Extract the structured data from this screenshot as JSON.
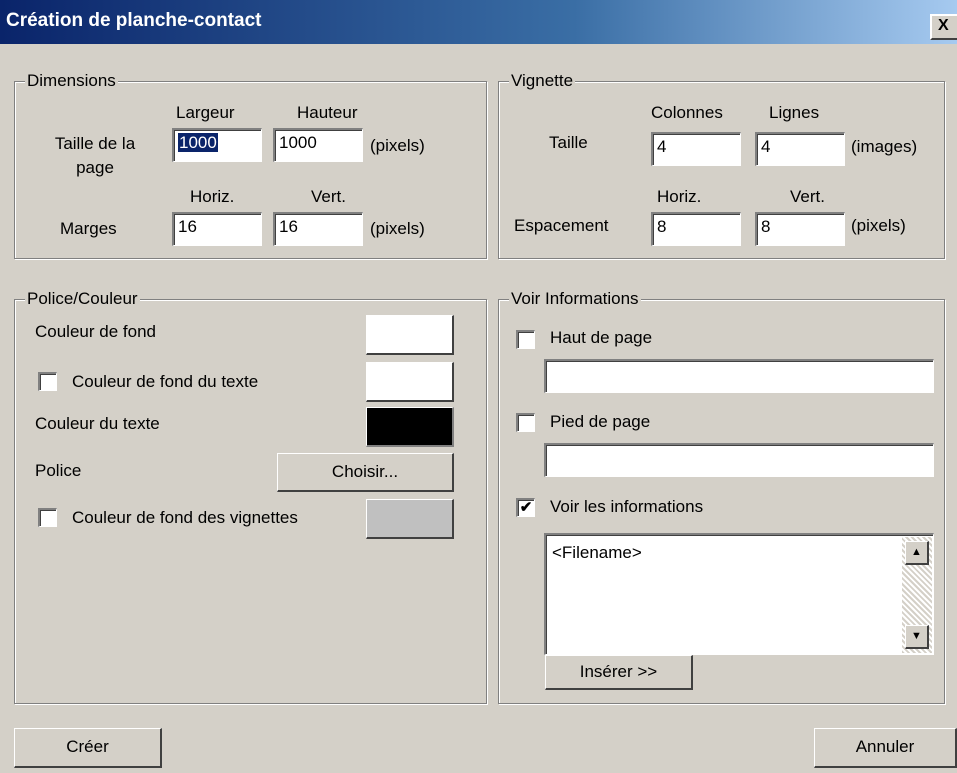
{
  "window": {
    "title": "Création de planche-contact",
    "close_label": "X"
  },
  "dimensions": {
    "legend": "Dimensions",
    "col_width": "Largeur",
    "col_height": "Hauteur",
    "page_size_label": "Taille de la page",
    "page_width": "1000",
    "page_height": "1000",
    "unit1": "(pixels)",
    "col_horiz": "Horiz.",
    "col_vert": "Vert.",
    "margins_label": "Marges",
    "margin_h": "16",
    "margin_v": "16",
    "unit2": "(pixels)"
  },
  "thumbnail": {
    "legend": "Vignette",
    "col_columns": "Colonnes",
    "col_rows": "Lignes",
    "size_label": "Taille",
    "columns": "4",
    "rows": "4",
    "unit1": "(images)",
    "col_horiz": "Horiz.",
    "col_vert": "Vert.",
    "spacing_label": "Espacement",
    "spacing_h": "8",
    "spacing_v": "8",
    "unit2": "(pixels)"
  },
  "font_color": {
    "legend": "Police/Couleur",
    "bg_color_label": "Couleur de fond",
    "bg_color": "#ffffff",
    "text_bg_label": "Couleur de fond du texte",
    "text_bg_checked": false,
    "text_bg_color": "#ffffff",
    "text_color_label": "Couleur du texte",
    "text_color": "#000000",
    "font_label": "Police",
    "choose_button": "Choisir...",
    "thumb_bg_label": "Couleur de fond des vignettes",
    "thumb_bg_checked": false,
    "thumb_bg_color": "#c0c0c0"
  },
  "info": {
    "legend": "Voir Informations",
    "header_label": "Haut de page",
    "header_checked": false,
    "header_value": "",
    "footer_label": "Pied de page",
    "footer_checked": false,
    "footer_value": "",
    "show_info_label": "Voir les informations",
    "show_info_checked": true,
    "info_text": "<Filename>",
    "insert_button": "Insérer >>"
  },
  "footer": {
    "create_button": "Créer",
    "cancel_button": "Annuler"
  }
}
